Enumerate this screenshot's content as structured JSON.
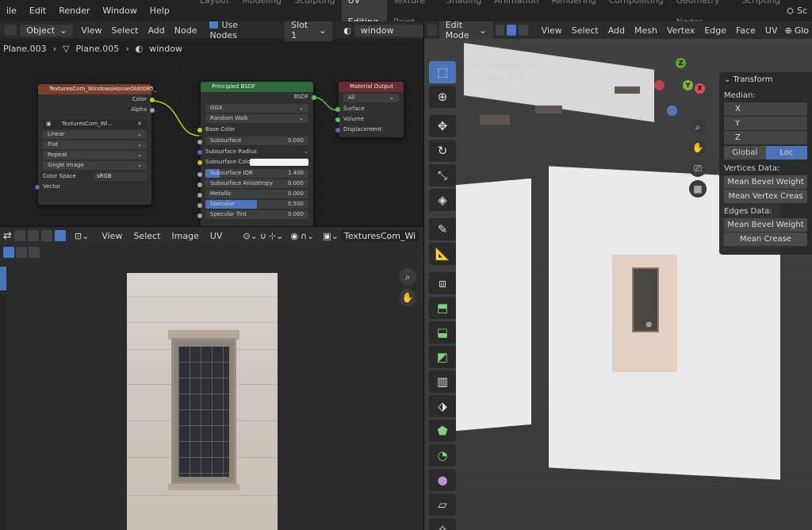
{
  "topbar": {
    "menus": [
      "ile",
      "Edit",
      "Render",
      "Window",
      "Help"
    ],
    "workspaces": [
      "Layout",
      "Modeling",
      "Sculpting",
      "UV Editing",
      "Texture Paint",
      "Shading",
      "Animation",
      "Rendering",
      "Compositing",
      "Geometry Nodes",
      "Scripting"
    ],
    "active_workspace": "UV Editing",
    "right_label": "Sc"
  },
  "node_editor": {
    "mode": "Object",
    "menus": [
      "View",
      "Select",
      "Add",
      "Node"
    ],
    "use_nodes_label": "Use Nodes",
    "slot": "Slot 1",
    "material": "window",
    "breadcrumbs": [
      "Plane.003",
      "Plane.005",
      "window"
    ],
    "image_node": {
      "title": "TexturesCom_WindowsHouseOld0085_",
      "outputs": [
        "Color",
        "Alpha"
      ],
      "image_name": "TexturesCom_Wi...",
      "interpolation": "Linear",
      "projection": "Flat",
      "extension": "Repeat",
      "source": "Single Image",
      "color_space_label": "Color Space",
      "color_space": "sRGB",
      "input": "Vector"
    },
    "bsdf_node": {
      "title": "Principled BSDF",
      "output": "BSDF",
      "distribution": "GGX",
      "subsurface_method": "Random Walk",
      "base_color": "Base Color",
      "fields": [
        {
          "label": "Subsurface",
          "value": "0.000"
        },
        {
          "label": "Subsurface Radius",
          "value": ""
        },
        {
          "label": "Subsurface Colo",
          "value": ""
        },
        {
          "label": "Subsurface IOR",
          "value": "1.400"
        },
        {
          "label": "Subsurface Anisotropy",
          "value": "0.000"
        },
        {
          "label": "Metallic",
          "value": "0.000"
        },
        {
          "label": "Specular",
          "value": "0.500"
        },
        {
          "label": "Specular Tint",
          "value": "0.000"
        }
      ]
    },
    "output_node": {
      "title": "Material Output",
      "target": "All",
      "inputs": [
        "Surface",
        "Volume",
        "Displacement"
      ]
    }
  },
  "uv_editor": {
    "menus": [
      "View",
      "Select",
      "Image",
      "UV"
    ],
    "image_name": "TexturesCom_Wi"
  },
  "viewport": {
    "mode": "Edit Mode",
    "menus": [
      "View",
      "Select",
      "Add",
      "Mesh",
      "Vertex",
      "Edge",
      "Face",
      "UV"
    ],
    "right_label": "Glo",
    "perspective": "User Perspective",
    "object": "(1) Plane.003",
    "axis_labels": [
      "X",
      "Y",
      "Z"
    ],
    "n_panel": {
      "title": "Transform",
      "median_label": "Median:",
      "median_fields": [
        "X",
        "Y",
        "Z"
      ],
      "space": [
        "Global",
        "Loc"
      ],
      "active_space": "Loc",
      "vertices_label": "Vertices Data:",
      "vertices_buttons": [
        "Mean Bevel Weight",
        "Mean Vertex Creas"
      ],
      "edges_label": "Edges Data:",
      "edges_buttons": [
        "Mean Bevel Weight",
        "Mean Crease"
      ]
    }
  },
  "colors": {
    "accent": "#4c74b9",
    "image_node_header": "#7a3e2a",
    "bsdf_node_header": "#2f6b3a",
    "output_node_header": "#6a2a36",
    "yellow_socket": "#c7c729",
    "green_socket": "#59c45b",
    "purple_socket": "#6363c7",
    "gray_socket": "#a1a1a1"
  }
}
